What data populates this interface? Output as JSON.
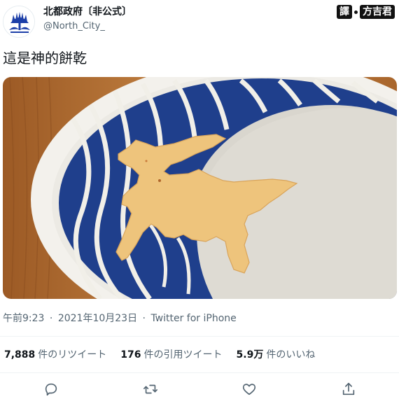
{
  "author": {
    "display_name": "北都政府〔非公式〕",
    "handle": "@North_City_"
  },
  "translator": {
    "prefix": "譯",
    "name": "方吉君"
  },
  "tweet": {
    "text": "這是神的餅乾",
    "time": "午前9:23",
    "date": "2021年10月23日",
    "source": "Twitter for iPhone",
    "separator": "·"
  },
  "stats": {
    "retweets": {
      "count": "7,888",
      "label": "件のリツイート"
    },
    "quotes": {
      "count": "176",
      "label": "件の引用ツイート"
    },
    "likes": {
      "count": "5.9万",
      "label": "件のいいね"
    }
  },
  "actions": {
    "reply": "reply-icon",
    "retweet": "retweet-icon",
    "like": "heart-icon",
    "share": "share-icon"
  },
  "colors": {
    "text": "#0f1419",
    "secondary": "#536471",
    "divider": "#eff3f4",
    "avatar_flower": "#1d3fa8",
    "plate_blue": "#1f3f8c",
    "wood": "#b8753a",
    "cookie": "#f0c77f"
  }
}
